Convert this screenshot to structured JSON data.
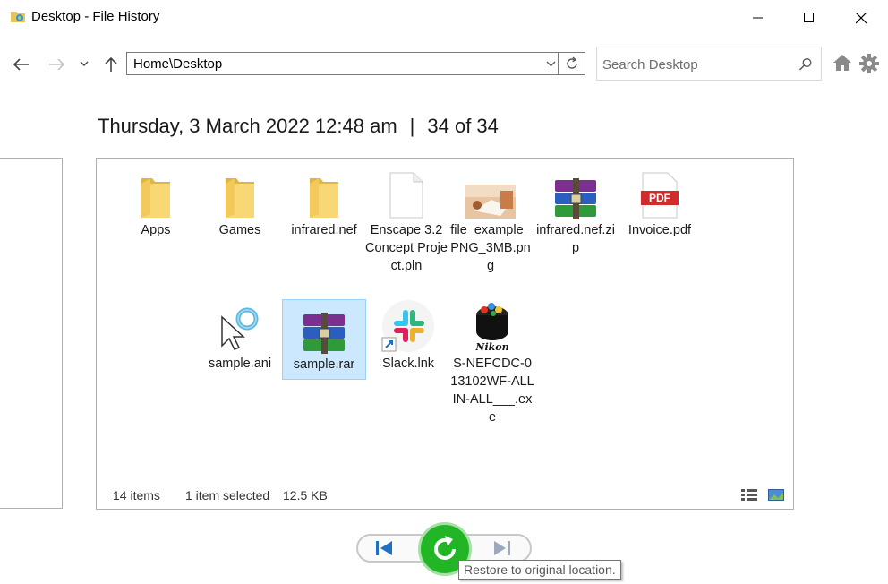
{
  "window": {
    "title": "Desktop - File History"
  },
  "nav": {
    "address": "Home\\Desktop",
    "search_placeholder": "Search Desktop"
  },
  "snapshot": {
    "date": "Thursday, 3 March 2022 12:48 am",
    "separator": "|",
    "position": "34 of 34"
  },
  "files": [
    {
      "name": "Apps",
      "icon": "folder-icon"
    },
    {
      "name": "Games",
      "icon": "folder-icon"
    },
    {
      "name": "infrared.nef",
      "icon": "folder-icon"
    },
    {
      "name": "Enscape 3.2 Concept Project.pln",
      "icon": "blank-file-icon"
    },
    {
      "name": "file_example_PNG_3MB.png",
      "icon": "image-thumbnail-icon"
    },
    {
      "name": "infrared.nef.zip",
      "icon": "archive-icon"
    },
    {
      "name": "Invoice.pdf",
      "icon": "pdf-icon"
    },
    {
      "name": "sample.ani",
      "icon": "animated-cursor-icon"
    },
    {
      "name": "sample.rar",
      "icon": "archive-icon",
      "selected": true
    },
    {
      "name": "Slack.lnk",
      "icon": "slack-shortcut-icon"
    },
    {
      "name": "S-NEFCDC-013102WF-ALLIN-ALL___.exe",
      "icon": "nikon-installer-icon"
    }
  ],
  "status": {
    "count": "14 items",
    "selection": "1 item selected",
    "size": "12.5 KB"
  },
  "controls": {
    "tooltip": "Restore to original location."
  },
  "colors": {
    "folder": "#f8d775",
    "selection_bg": "#cce8ff",
    "restore_green": "#22b626"
  }
}
